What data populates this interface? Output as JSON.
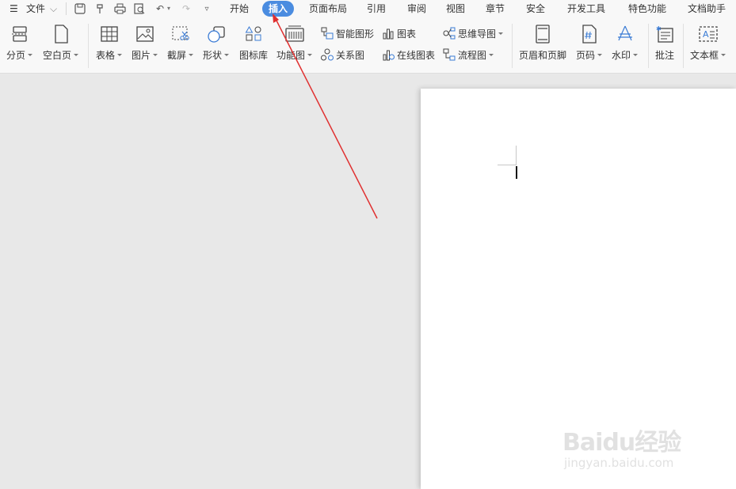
{
  "menu": {
    "file_label": "文件",
    "tabs": [
      "开始",
      "插入",
      "页面布局",
      "引用",
      "审阅",
      "视图",
      "章节",
      "安全",
      "开发工具",
      "特色功能",
      "文档助手"
    ],
    "active_tab": "插入"
  },
  "ribbon": {
    "page_break": "分页",
    "blank_page": "空白页",
    "table": "表格",
    "picture": "图片",
    "screenshot": "截屏",
    "shape": "形状",
    "icon_library": "图标库",
    "function_chart": "功能图",
    "smart_art": "智能图形",
    "relation_chart": "关系图",
    "chart": "图表",
    "online_chart": "在线图表",
    "mind_map": "思维导图",
    "flowchart": "流程图",
    "header_footer": "页眉和页脚",
    "page_number": "页码",
    "watermark": "水印",
    "comment": "批注",
    "textbox": "文本框"
  },
  "watermark_overlay": {
    "brand": "Baidu经验",
    "site": "jingyan.baidu.com"
  },
  "colors": {
    "accent": "#4a8ce0",
    "arrow": "#e03030"
  }
}
